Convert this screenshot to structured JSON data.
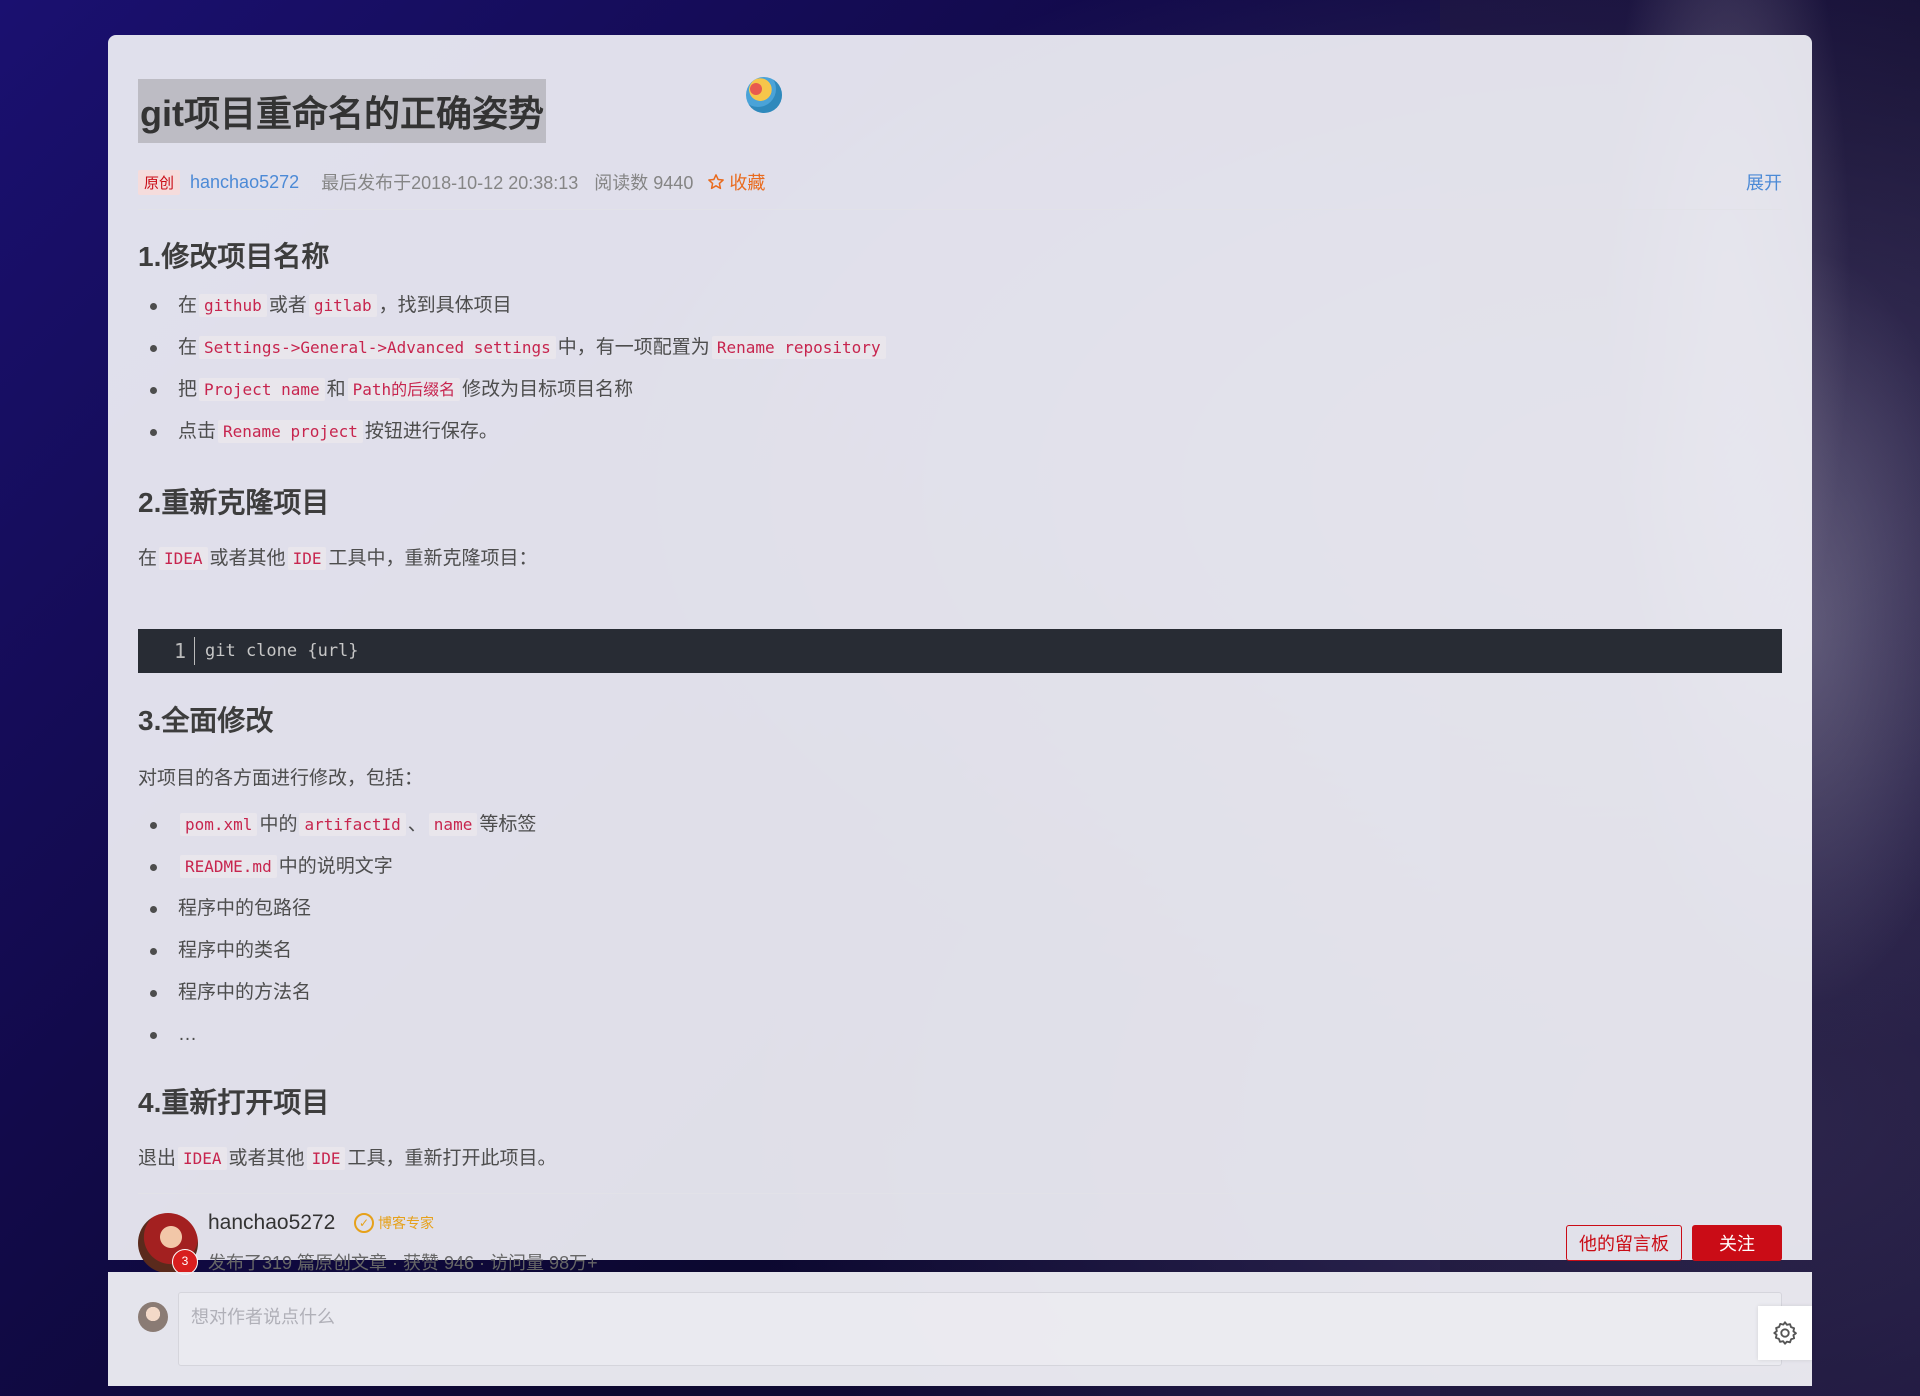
{
  "article": {
    "title": "git项目重命名的正确姿势",
    "tag": "原创",
    "author": "hanchao5272",
    "publish_label": "最后发布于2018-10-12 20:38:13",
    "read_label": "阅读数 9440",
    "favorite_label": "收藏",
    "expand_label": "展开"
  },
  "sections": {
    "s1": {
      "heading": "1.修改项目名称",
      "items": [
        {
          "t1": "在",
          "c1": "github",
          "t2": "或者",
          "c2": "gitlab",
          "t3": "，找到具体项目"
        },
        {
          "t1": "在",
          "c1": "Settings->General->Advanced settings",
          "t2": "中，有一项配置为",
          "c2": "Rename repository"
        },
        {
          "t1": "把",
          "c1": "Project name",
          "t2": "和",
          "c2": "Path的后缀名",
          "t3": "修改为目标项目名称"
        },
        {
          "t1": "点击",
          "c1": "Rename project",
          "t2": "按钮进行保存。"
        }
      ]
    },
    "s2": {
      "heading": "2.重新克隆项目",
      "p": {
        "t1": "在",
        "c1": "IDEA",
        "t2": "或者其他",
        "c2": "IDE",
        "t3": "工具中，重新克隆项目："
      },
      "code_line_no": "1",
      "code": "git clone {url}"
    },
    "s3": {
      "heading": "3.全面修改",
      "intro": "对项目的各方面进行修改，包括：",
      "items": [
        {
          "c1": "pom.xml",
          "t1": "中的",
          "c2": "artifactId",
          "t2": "、",
          "c3": "name",
          "t3": "等标签"
        },
        {
          "c1": "README.md",
          "t1": "中的说明文字"
        },
        {
          "t1": "程序中的包路径"
        },
        {
          "t1": "程序中的类名"
        },
        {
          "t1": "程序中的方法名"
        },
        {
          "t1": "…"
        }
      ]
    },
    "s4": {
      "heading": "4.重新打开项目",
      "p": {
        "t1": "退出",
        "c1": "IDEA",
        "t2": "或者其他",
        "c2": "IDE",
        "t3": "工具，重新打开此项目。"
      }
    }
  },
  "author_box": {
    "name": "hanchao5272",
    "badge_years": "3",
    "expert_label": "博客专家",
    "stats": "发布了319 篇原创文章 · 获赞 946 · 访问量 98万+",
    "board_btn": "他的留言板",
    "follow_btn": "关注"
  },
  "comment": {
    "placeholder": "想对作者说点什么"
  },
  "colors": {
    "accent": "#ca0c16",
    "link": "#4c8ad6",
    "favorite": "#e96b1e",
    "code_text": "#c7254e",
    "code_bg": "#282c34"
  },
  "icons": [
    "star-icon",
    "expert-icon",
    "gear-icon",
    "decoration-icon"
  ]
}
